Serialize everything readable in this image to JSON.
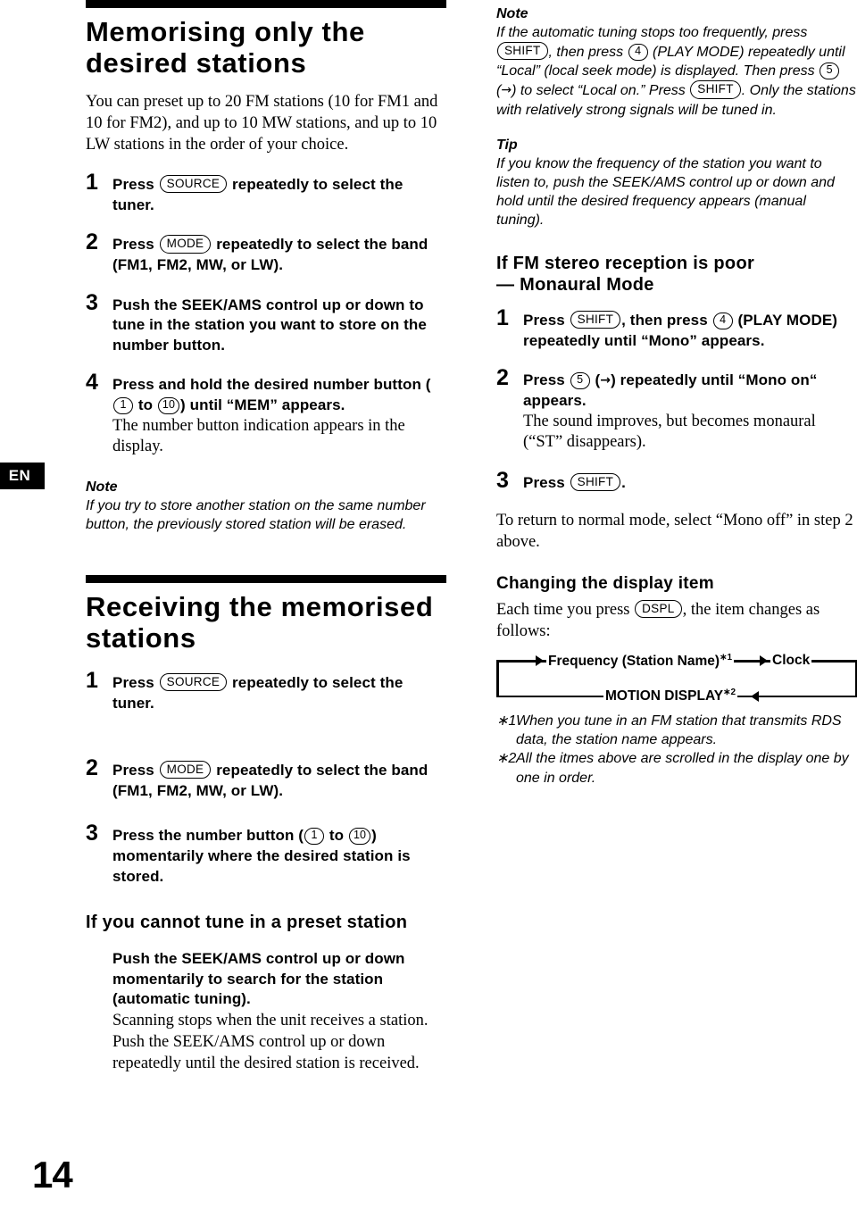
{
  "page": {
    "number": "14",
    "language_tab": "EN"
  },
  "left_column": {
    "section1": {
      "heading": "Memorising only the desired stations",
      "intro": "You can preset up to 20 FM stations (10 for FM1 and 10 for FM2), and up to 10 MW stations, and up to 10 LW stations in the order of your choice.",
      "steps": [
        {
          "num": "1",
          "pre": "Press",
          "button": "SOURCE",
          "post": "repeatedly to select the tuner."
        },
        {
          "num": "2",
          "pre": "Press",
          "button": "MODE",
          "post": "repeatedly to select the band (FM1, FM2, MW, or LW)."
        },
        {
          "num": "3",
          "text": "Push the SEEK/AMS control up or down to tune in the station you want to store on the number button."
        },
        {
          "num": "4",
          "pre": "Press and hold the desired number button (",
          "btn_from": "1",
          "mid": "to",
          "btn_to": "10",
          "post": ") until “MEM” appears.",
          "detail": "The number button indication appears in the display."
        }
      ],
      "note": {
        "label": "Note",
        "text": "If you try to store another station on the same number button, the previously stored station will be erased."
      }
    },
    "section2": {
      "heading": "Receiving the memorised stations",
      "steps": [
        {
          "num": "1",
          "pre": "Press",
          "button": "SOURCE",
          "post": "repeatedly to select the tuner."
        },
        {
          "num": "2",
          "pre": "Press",
          "button": "MODE",
          "post": "repeatedly to select the band (FM1, FM2, MW, or LW)."
        },
        {
          "num": "3",
          "pre": "Press the number button (",
          "btn_from": "1",
          "mid": "to",
          "btn_to": "10",
          "post": ") momentarily where the desired station is stored."
        }
      ],
      "subsection": {
        "heading": "If you cannot tune in a preset station",
        "bold": "Push the SEEK/AMS control up or down momentarily to search for the station (automatic tuning).",
        "detail": "Scanning stops when the unit receives a station. Push the SEEK/AMS control up or down repeatedly until the desired station is received."
      }
    }
  },
  "right_column": {
    "note": {
      "label": "Note",
      "p1": "If the automatic tuning stops too frequently, press",
      "btn_shift1": "SHIFT",
      "p2": ", then press",
      "btn_4": "4",
      "p3": "(PLAY MODE) repeatedly until “Local” (local seek mode) is displayed. Then press",
      "btn_5": "5",
      "p4": "(",
      "arrow": "→",
      "p5": ") to select “Local on.” Press",
      "btn_shift2": "SHIFT",
      "p6": ". Only the stations with relatively strong signals will be tuned in."
    },
    "tip": {
      "label": "Tip",
      "text": "If you know the frequency of the station you want to listen to, push the SEEK/AMS control up or down and hold until the desired frequency appears (manual tuning)."
    },
    "mono": {
      "heading_line1": "If FM stereo reception is poor",
      "heading_line2": "— Monaural Mode",
      "steps": [
        {
          "num": "1",
          "pre": "Press",
          "btn_shift": "SHIFT",
          "mid": ", then press",
          "btn_num": "4",
          "post": "(PLAY MODE) repeatedly until “Mono” appears."
        },
        {
          "num": "2",
          "pre": "Press",
          "btn_num": "5",
          "mid": "(",
          "arrow": "→",
          "post": ") repeatedly until “Mono on“ appears.",
          "detail": "The sound improves, but becomes monaural (“ST” disappears)."
        },
        {
          "num": "3",
          "pre": "Press",
          "btn_shift": "SHIFT",
          "post": "."
        }
      ],
      "closing": "To return to normal mode, select “Mono off” in step 2 above."
    },
    "display_item": {
      "heading": "Changing the display item",
      "intro_pre": "Each time you press",
      "button": "DSPL",
      "intro_post": ", the item changes as follows:",
      "flow": {
        "node1": "Frequency (Station Name)",
        "node1_fn": "∗1",
        "node2": "Clock",
        "node3": "MOTION DISPLAY",
        "node3_fn": "∗2"
      },
      "footnotes": [
        {
          "marker": "∗1",
          "text": "When you tune in an FM station that transmits RDS data, the station name appears."
        },
        {
          "marker": "∗2",
          "text": "All the itmes above are scrolled in the display one by one in order."
        }
      ]
    }
  }
}
